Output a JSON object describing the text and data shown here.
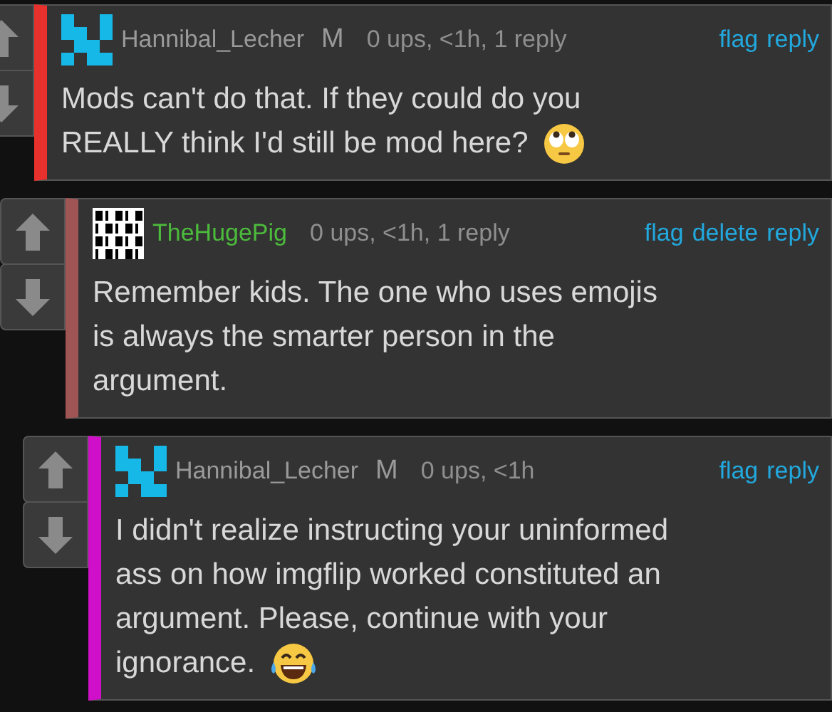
{
  "comments": [
    {
      "author": "Hannibal_Lecher",
      "avatar": {
        "kind": "identicon"
      },
      "badge": "M",
      "is_op": false,
      "color": "#e8302c",
      "meta": "0 ups, <1h, 1 reply",
      "actions": [
        "flag",
        "reply"
      ],
      "lines": [
        "Mods can't do that. If they could do you",
        "REALLY think I'd still be mod here?"
      ],
      "emoji": {
        "kind": "rolling-eyes"
      },
      "children": [
        {
          "author": "TheHugePig",
          "avatar": {
            "kind": "binary"
          },
          "is_op": true,
          "color": "#a05555",
          "meta": "0 ups, <1h, 1 reply",
          "actions": [
            "flag",
            "delete",
            "reply"
          ],
          "lines": [
            "Remember kids. The one who uses emojis",
            "is always the smarter person in the",
            "argument."
          ],
          "children": [
            {
              "author": "Hannibal_Lecher",
              "avatar": {
                "kind": "identicon"
              },
              "badge": "M",
              "is_op": false,
              "color": "#d010c8",
              "meta": "0 ups, <1h",
              "actions": [
                "flag",
                "reply"
              ],
              "lines": [
                "I didn't realize instructing your uninformed",
                "ass on how imgflip worked constituted an",
                "argument. Please, continue with your",
                "ignorance."
              ],
              "emoji": {
                "kind": "tears-of-joy"
              }
            }
          ]
        }
      ]
    }
  ]
}
